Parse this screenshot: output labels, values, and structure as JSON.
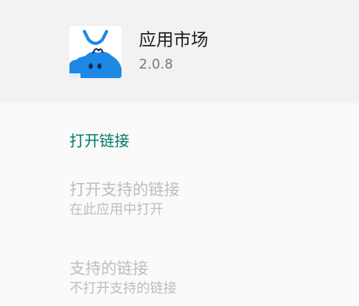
{
  "app": {
    "name": "应用市场",
    "version": "2.0.8",
    "icon": "app-store-bag-icon",
    "colors": {
      "brand_blue": "#1e88e5",
      "icon_bg": "#ffffff"
    }
  },
  "section": {
    "title": "打开链接"
  },
  "preferences": [
    {
      "title": "打开支持的链接",
      "summary": "在此应用中打开",
      "enabled": false
    },
    {
      "title": "支持的链接",
      "summary": "不打开支持的链接",
      "enabled": false
    }
  ],
  "colors": {
    "header_bg": "#f2f2f2",
    "page_bg": "#fafafa",
    "accent": "#00796b",
    "disabled_text": "#bdbdbd"
  }
}
